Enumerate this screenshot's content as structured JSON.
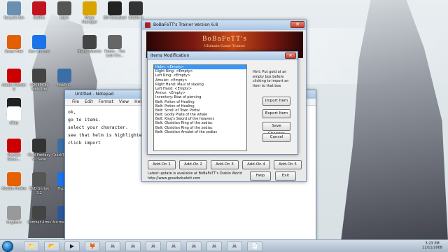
{
  "desktop_icons": [
    {
      "label": "Recycle Bin",
      "icon": "recycle-bin-icon",
      "color": "#6b8fb0"
    },
    {
      "label": "Netflix",
      "icon": "netflix-icon",
      "color": "#c1121f"
    },
    {
      "label": "Inkm",
      "icon": "app-icon",
      "color": "#555"
    },
    {
      "label": "Mega Manager",
      "icon": "mega-icon",
      "color": "#d9a300"
    },
    {
      "label": "EM Reloaded",
      "icon": "game-icon",
      "color": "#222"
    },
    {
      "label": "Diablo II",
      "icon": "diablo-icon",
      "color": "#333"
    },
    {
      "label": "Avast Free",
      "icon": "avast-icon",
      "color": "#e35f00"
    },
    {
      "label": "Ace Chrome",
      "icon": "chrome-icon",
      "color": "#1a73e8"
    },
    {
      "label": "Blade Warrior",
      "icon": "blade-icon",
      "color": "#444"
    },
    {
      "label": "Public - The Lost Chr...",
      "icon": "folder-icon",
      "color": "#666"
    },
    {
      "label": "Adobe Reader 9",
      "icon": "pdf-icon",
      "color": "#c00"
    },
    {
      "label": "POKEMON Tools Lite",
      "icon": "pokemon-icon",
      "color": "#444"
    },
    {
      "label": "FinePri...",
      "icon": "printer-icon",
      "color": "#3a6ea5"
    },
    {
      "label": "FF7CHE",
      "icon": "app-icon",
      "color": "#222"
    },
    {
      "label": "eBay",
      "icon": "ebay-icon",
      "color": "#fff"
    },
    {
      "label": "McAfee Secur...",
      "icon": "mcafee-icon",
      "color": "#c00"
    },
    {
      "label": "Final Fantasy VII Save",
      "icon": "ff-icon",
      "color": "#333"
    },
    {
      "label": "QuickT Player",
      "icon": "quicktime-icon",
      "color": "#3a6ea5"
    },
    {
      "label": "Mozilla Firefox",
      "icon": "firefox-icon",
      "color": "#e66000"
    },
    {
      "label": "DVD Shrink 3.2",
      "icon": "dvd-icon",
      "color": "#555"
    },
    {
      "label": "Hyper...",
      "icon": "app-icon",
      "color": "#1a73e8"
    },
    {
      "label": "ImgBurn",
      "icon": "imgburn-icon",
      "color": "#999"
    },
    {
      "label": "Combat Arms",
      "icon": "game-icon",
      "color": "#444"
    },
    {
      "label": "Microso Word",
      "icon": "word-icon",
      "color": "#2b579a"
    }
  ],
  "notepad": {
    "title": "Untitled - Notepad",
    "menu": [
      "File",
      "Edit",
      "Format",
      "View",
      "Help"
    ],
    "lines": [
      "ok,",
      "go to items.",
      "select your character.",
      "see that helm is highlighted",
      "click import"
    ]
  },
  "trainer": {
    "title": "BoBaFeTT's Trainer Version 6.8",
    "close_glyph": "✕",
    "banner_line1": "BoBaFeTT's",
    "banner_line2": "Ultimate Game Trainer",
    "addons": [
      "Add-On 1",
      "Add-On 2",
      "Add-On 3",
      "Add-On 4",
      "Add-On 5"
    ],
    "footer_line1": "Latest update is available at BoBaFeTT's Diablo World",
    "footer_line2": "http://www.greatbobafett.com",
    "help_label": "Help",
    "exit_label": "Exit"
  },
  "items_dialog": {
    "title": "Items Modification",
    "close_glyph": "✕",
    "list": [
      "Helm: <Empty>",
      "Right Ring: <Empty>",
      "Left Ring: <Empty>",
      "Amulet: <Empty>",
      "Right Hand: Maul of slaying",
      "Left Hand: <Empty>",
      "Armor: <Empty>",
      "Inventory: Bow of piercing",
      "Belt: Potion of Healing",
      "Belt: Potion of Healing",
      "Belt: Scroll of Town Portal",
      "Belt: Godly Plate of the whale",
      "Belt: King's Sword of the heavens",
      "Belt: Obsidian Ring of the zodiac",
      "Belt: Obsidian Ring of the zodiac",
      "Belt: Obsidian Amulet of the zodiac"
    ],
    "selected_index": 0,
    "hint": "Hint: Put gold at an empty box before clicking to import an item to that box",
    "import_label": "Import Item",
    "export_label": "Export Item",
    "save_label": "Save Changes",
    "cancel_label": "Cancel"
  },
  "taskbar": {
    "items": [
      "📁",
      "📂",
      "▶",
      "🦊",
      "☠",
      "☠",
      "☠",
      "☠",
      "☠",
      "☠",
      "☠",
      "📄"
    ],
    "time": "3:23 PM",
    "date": "12/11/2008"
  }
}
